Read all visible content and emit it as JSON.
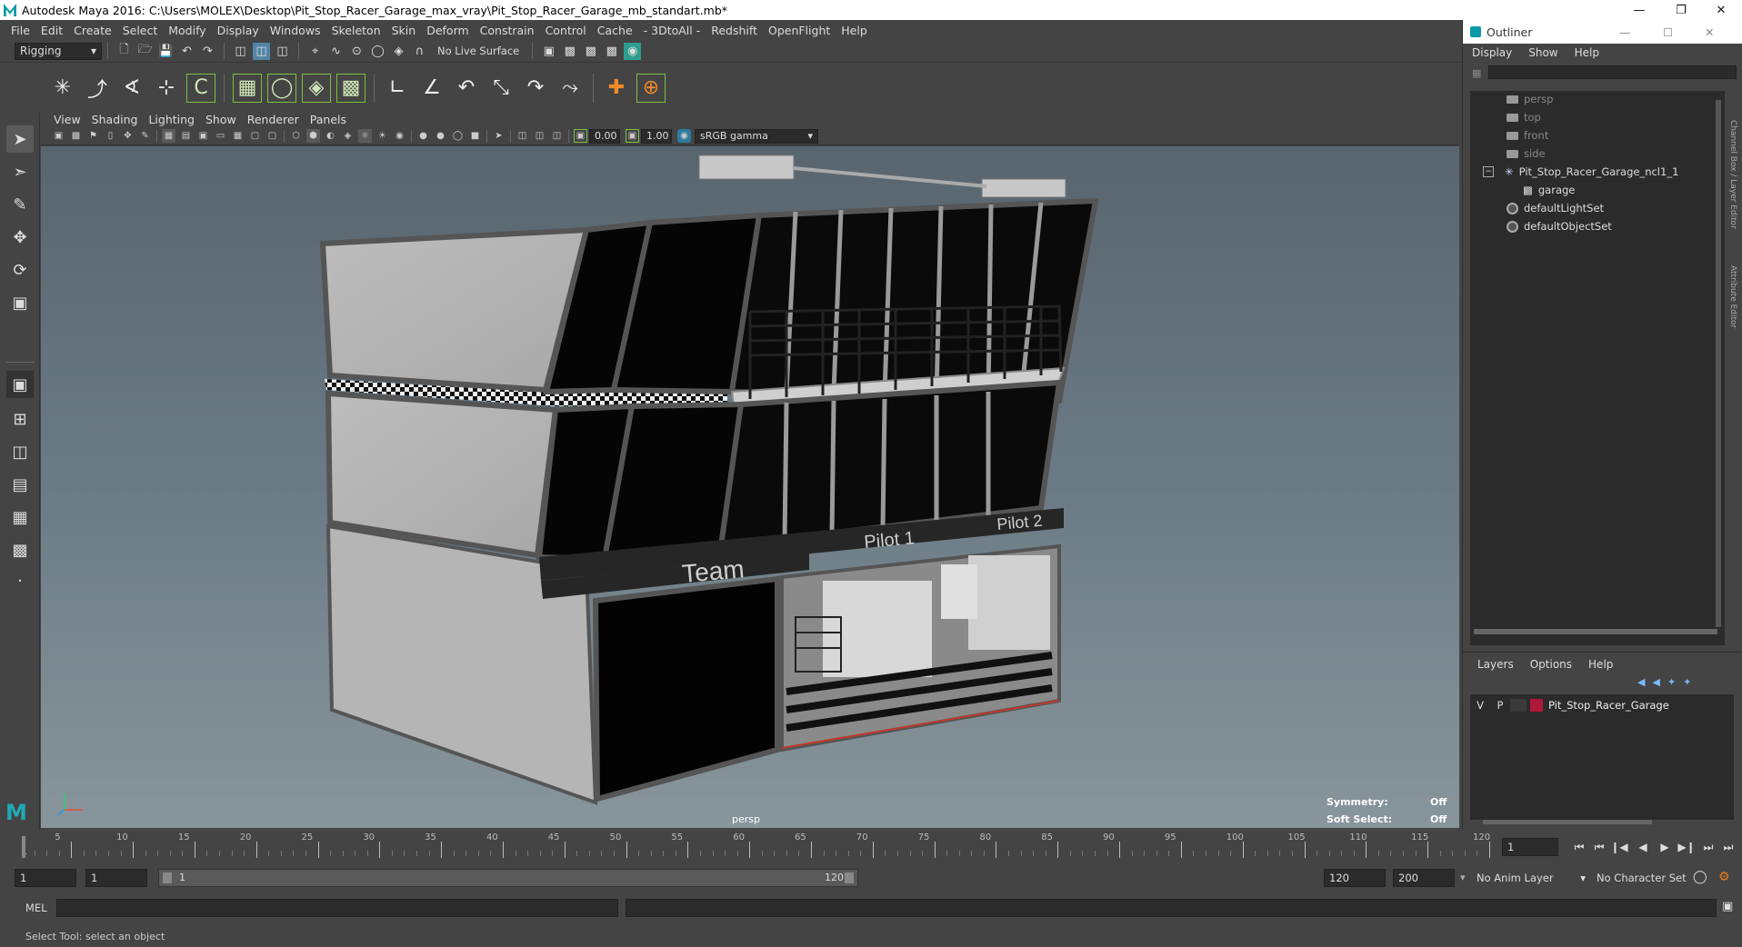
{
  "window": {
    "title": "Autodesk Maya 2016: C:\\Users\\MOLEX\\Desktop\\Pit_Stop_Racer_Garage_max_vray\\Pit_Stop_Racer_Garage_mb_standart.mb*"
  },
  "menu": [
    "File",
    "Edit",
    "Create",
    "Select",
    "Modify",
    "Display",
    "Windows",
    "Skeleton",
    "Skin",
    "Deform",
    "Constrain",
    "Control",
    "Cache",
    "- 3DtoAll -",
    "Redshift",
    "OpenFlight",
    "Help"
  ],
  "toolbar": {
    "mode": "Rigging",
    "live_surface": "No Live Surface"
  },
  "panel": {
    "menu": [
      "View",
      "Shading",
      "Lighting",
      "Show",
      "Renderer",
      "Panels"
    ],
    "near_value": "0.00",
    "far_value": "1.00",
    "color_space": "sRGB gamma"
  },
  "viewport": {
    "camera": "persp",
    "symmetry_label": "Symmetry:",
    "symmetry_value": "Off",
    "soft_select_label": "Soft Select:",
    "soft_select_value": "Off",
    "sign_team": "Team",
    "sign_pilot1": "Pilot 1",
    "sign_pilot2": "Pilot 2"
  },
  "outliner": {
    "title": "Outliner",
    "menu": [
      "Display",
      "Show",
      "Help"
    ],
    "items": [
      {
        "label": "persp",
        "type": "camera",
        "dim": true
      },
      {
        "label": "top",
        "type": "camera",
        "dim": true
      },
      {
        "label": "front",
        "type": "camera",
        "dim": true
      },
      {
        "label": "side",
        "type": "camera",
        "dim": true
      },
      {
        "label": "Pit_Stop_Racer_Garage_ncl1_1",
        "type": "group",
        "dim": false
      },
      {
        "label": "garage",
        "type": "mesh",
        "dim": false
      },
      {
        "label": "defaultLightSet",
        "type": "set",
        "dim": false
      },
      {
        "label": "defaultObjectSet",
        "type": "set",
        "dim": false
      }
    ],
    "side_tabs": [
      "Channel Box / Layer Editor",
      "Attribute Editor"
    ]
  },
  "layers": {
    "menu": [
      "Layers",
      "Options",
      "Help"
    ],
    "row": {
      "v": "V",
      "p": "P",
      "name": "Pit_Stop_Racer_Garage",
      "color": "#b0173a"
    }
  },
  "timeline": {
    "ticks": [
      1,
      5,
      10,
      15,
      20,
      25,
      30,
      35,
      40,
      45,
      50,
      55,
      60,
      65,
      70,
      75,
      80,
      85,
      90,
      95,
      100,
      105,
      110,
      115,
      120
    ],
    "current_frame": "1",
    "start": 1,
    "end": 120
  },
  "range": {
    "start": "1",
    "playback_start": "1",
    "slider_start": "1",
    "slider_end": "120",
    "playback_end": "120",
    "end": "200",
    "anim_layer": "No Anim Layer",
    "character_set": "No Character Set"
  },
  "command": {
    "label": "MEL"
  },
  "help": {
    "text": "Select Tool: select an object"
  }
}
